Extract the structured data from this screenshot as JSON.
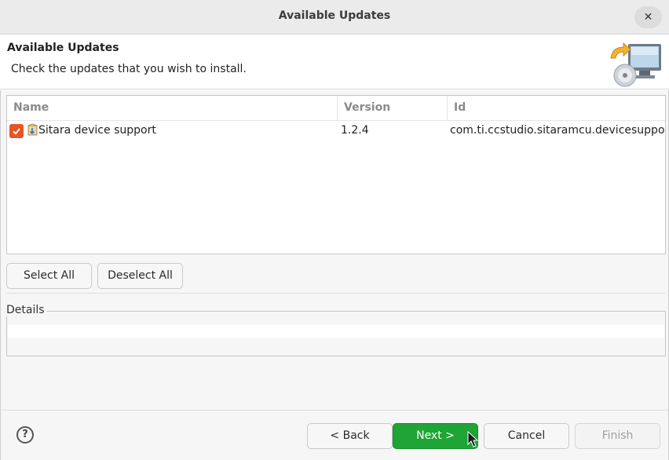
{
  "window": {
    "title": "Available Updates",
    "close_label": "✕"
  },
  "header": {
    "title": "Available Updates",
    "description": "Check the updates that you wish to install.",
    "icon": "install-updates-icon"
  },
  "table": {
    "columns": [
      "Name",
      "Version",
      "Id"
    ],
    "rows": [
      {
        "checked": true,
        "name": "Sitara device support",
        "version": "1.2.4",
        "id": "com.ti.ccstudio.sitaramcu.devicesupport"
      }
    ]
  },
  "selection_buttons": {
    "select_all": "Select All",
    "deselect_all": "Deselect All"
  },
  "details": {
    "label": "Details"
  },
  "footer": {
    "help_label": "?",
    "back": "< Back",
    "next": "Next >",
    "cancel": "Cancel",
    "finish": "Finish"
  },
  "colors": {
    "accent_checkbox": "#e95420",
    "next_button": "#1ea535"
  }
}
